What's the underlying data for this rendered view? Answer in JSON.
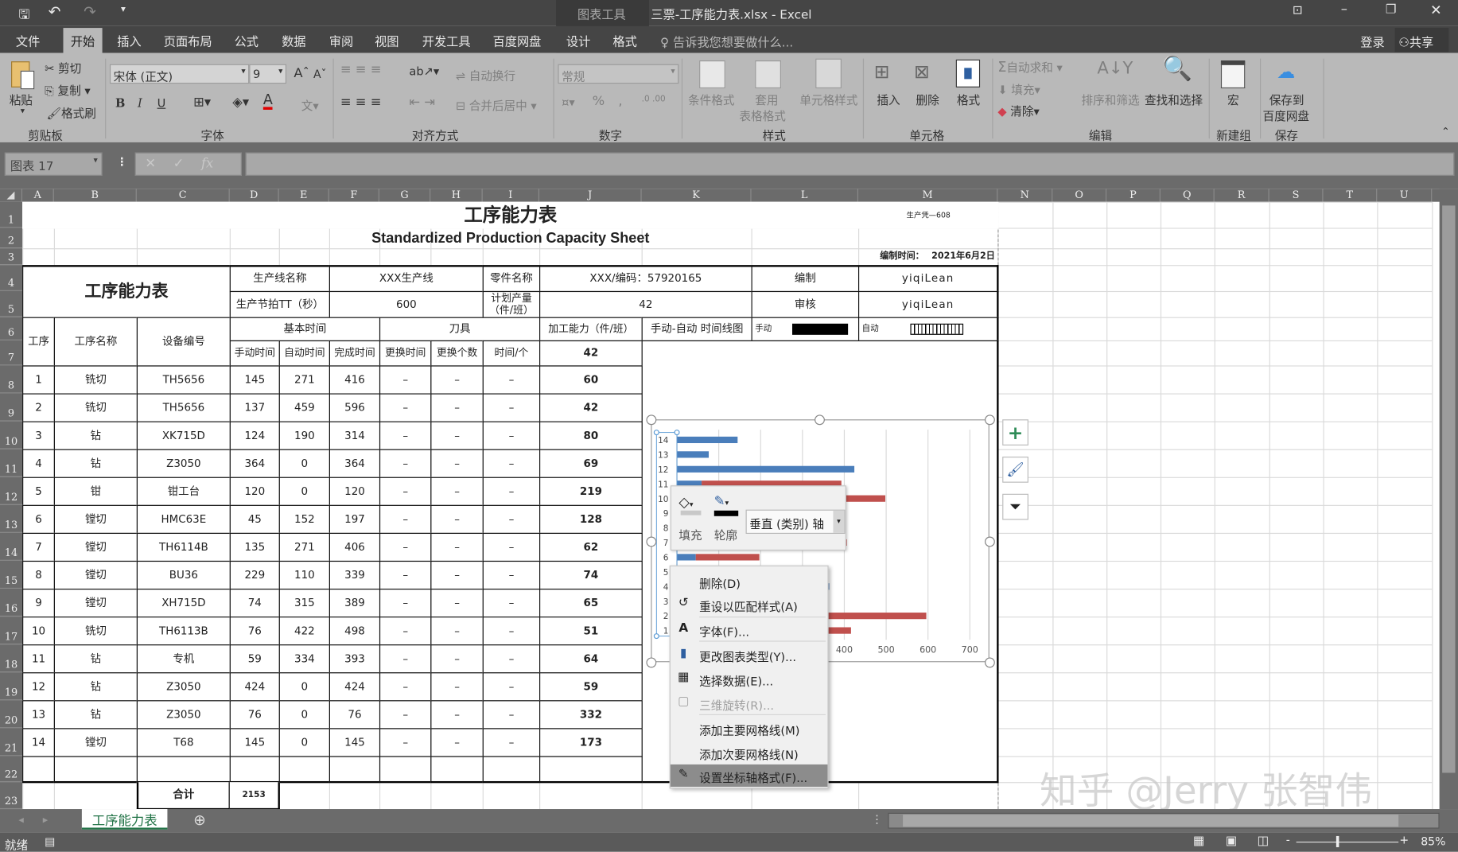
{
  "titlebar": {
    "context_tab": "图表工具",
    "title": "三票-工序能力表.xlsx - Excel"
  },
  "menu_tabs": [
    "文件",
    "开始",
    "插入",
    "页面布局",
    "公式",
    "数据",
    "审阅",
    "视图",
    "开发工具",
    "百度网盘",
    "设计",
    "格式"
  ],
  "tell_me": "告诉我您想要做什么...",
  "login": "登录",
  "share": "共享",
  "ribbon": {
    "clipboard": {
      "paste": "粘贴",
      "cut": "剪切",
      "copy": "复制",
      "format_painter": "格式刷",
      "group": "剪贴板"
    },
    "font": {
      "font_name": "宋体 (正文)",
      "font_size": "9",
      "bold": "B",
      "italic": "I",
      "underline": "U",
      "group": "字体"
    },
    "alignment": {
      "wrap": "自动换行",
      "merge": "合并后居中",
      "group": "对齐方式"
    },
    "number": {
      "format": "常规",
      "percent": "%",
      "comma": ",",
      "group": "数字"
    },
    "styles": {
      "conditional": "条件格式",
      "table_format_1": "套用",
      "table_format_2": "表格格式",
      "cell_styles": "单元格样式",
      "group": "样式"
    },
    "cells": {
      "insert": "插入",
      "delete": "删除",
      "format": "格式",
      "group": "单元格"
    },
    "editing": {
      "autosum": "自动求和",
      "fill": "填充",
      "clear": "清除",
      "sort_filter": "排序和筛选",
      "find_select": "查找和选择",
      "group": "编辑"
    },
    "newgroup": {
      "macro": "宏",
      "group": "新建组"
    },
    "save": {
      "save_1": "保存到",
      "save_2": "百度网盘",
      "group": "保存"
    }
  },
  "namebox": "图表 17",
  "fx": "fx",
  "columns": [
    "A",
    "B",
    "C",
    "D",
    "E",
    "F",
    "G",
    "H",
    "I",
    "J",
    "K",
    "L",
    "M",
    "N",
    "O",
    "P",
    "Q",
    "R",
    "S",
    "T",
    "U"
  ],
  "rows": [
    "1",
    "2",
    "3",
    "4",
    "5",
    "6",
    "7",
    "8",
    "9",
    "10",
    "11",
    "12",
    "13",
    "14",
    "15",
    "16",
    "17",
    "18",
    "19",
    "20",
    "21",
    "22",
    "23"
  ],
  "sheet": {
    "title": "工序能力表",
    "subtitle": "Standardized Production Capacity Sheet",
    "doc_no": "生产凭—608",
    "date_label": "编制时间：",
    "date": "2021年6月2日",
    "left_title": "工序能力表",
    "line_name_label": "生产线名称",
    "line_name": "XXX生产线",
    "part_name_label": "零件名称",
    "part_name": "XXX/编码：57920165",
    "compiled_label": "编制",
    "compiled_by": "yiqiLean",
    "takt_label": "生产节拍TT（秒）",
    "takt": "600",
    "plan_label": "计划产量（件/班）",
    "plan": "42",
    "review_label": "审核",
    "reviewed_by": "yiqiLean",
    "h_seq": "工序",
    "h_name": "工序名称",
    "h_equip": "设备编号",
    "h_basic": "基本时间",
    "h_tool": "刀具",
    "h_capacity": "加工能力（件/班）",
    "h_timeline": "手动-自动 时间线图",
    "legend_manual": "手动",
    "legend_auto": "自动",
    "h_manual": "手动时间",
    "h_auto": "自动时间",
    "h_total": "完成时间",
    "h_change_time": "更换时间",
    "h_change_count": "更换个数",
    "h_per_piece": "时间/个",
    "min_capacity": "42",
    "process_rows": [
      {
        "seq": "1",
        "name": "铣切",
        "equip": "TH5656",
        "manual": "145",
        "auto": "271",
        "total": "416",
        "ct": "–",
        "cc": "–",
        "pp": "–",
        "cap": "60"
      },
      {
        "seq": "2",
        "name": "铣切",
        "equip": "TH5656",
        "manual": "137",
        "auto": "459",
        "total": "596",
        "ct": "–",
        "cc": "–",
        "pp": "–",
        "cap": "42"
      },
      {
        "seq": "3",
        "name": "钻",
        "equip": "XK715D",
        "manual": "124",
        "auto": "190",
        "total": "314",
        "ct": "–",
        "cc": "–",
        "pp": "–",
        "cap": "80"
      },
      {
        "seq": "4",
        "name": "钻",
        "equip": "Z3050",
        "manual": "364",
        "auto": "0",
        "total": "364",
        "ct": "–",
        "cc": "–",
        "pp": "–",
        "cap": "69"
      },
      {
        "seq": "5",
        "name": "钳",
        "equip": "钳工台",
        "manual": "120",
        "auto": "0",
        "total": "120",
        "ct": "–",
        "cc": "–",
        "pp": "–",
        "cap": "219"
      },
      {
        "seq": "6",
        "name": "镗切",
        "equip": "HMC63E",
        "manual": "45",
        "auto": "152",
        "total": "197",
        "ct": "–",
        "cc": "–",
        "pp": "–",
        "cap": "128"
      },
      {
        "seq": "7",
        "name": "镗切",
        "equip": "TH6114B",
        "manual": "135",
        "auto": "271",
        "total": "406",
        "ct": "–",
        "cc": "–",
        "pp": "–",
        "cap": "62"
      },
      {
        "seq": "8",
        "name": "镗切",
        "equip": "BU36",
        "manual": "229",
        "auto": "110",
        "total": "339",
        "ct": "–",
        "cc": "–",
        "pp": "–",
        "cap": "74"
      },
      {
        "seq": "9",
        "name": "镗切",
        "equip": "XH715D",
        "manual": "74",
        "auto": "315",
        "total": "389",
        "ct": "–",
        "cc": "–",
        "pp": "–",
        "cap": "65"
      },
      {
        "seq": "10",
        "name": "铣切",
        "equip": "TH6113B",
        "manual": "76",
        "auto": "422",
        "total": "498",
        "ct": "–",
        "cc": "–",
        "pp": "–",
        "cap": "51"
      },
      {
        "seq": "11",
        "name": "钻",
        "equip": "专机",
        "manual": "59",
        "auto": "334",
        "total": "393",
        "ct": "–",
        "cc": "–",
        "pp": "–",
        "cap": "64"
      },
      {
        "seq": "12",
        "name": "钻",
        "equip": "Z3050",
        "manual": "424",
        "auto": "0",
        "total": "424",
        "ct": "–",
        "cc": "–",
        "pp": "–",
        "cap": "59"
      },
      {
        "seq": "13",
        "name": "钻",
        "equip": "Z3050",
        "manual": "76",
        "auto": "0",
        "total": "76",
        "ct": "–",
        "cc": "–",
        "pp": "–",
        "cap": "332"
      },
      {
        "seq": "14",
        "name": "镗切",
        "equip": "T68",
        "manual": "145",
        "auto": "0",
        "total": "145",
        "ct": "–",
        "cc": "–",
        "pp": "–",
        "cap": "173"
      }
    ],
    "total_label": "合计",
    "total": "2153"
  },
  "chart_data": {
    "type": "bar",
    "orientation": "horizontal",
    "stacked": true,
    "categories": [
      "1",
      "2",
      "3",
      "4",
      "5",
      "6",
      "7",
      "8",
      "9",
      "10",
      "11",
      "12",
      "13",
      "14"
    ],
    "series": [
      {
        "name": "手动时间",
        "color": "#4a7ebb",
        "values": [
          145,
          137,
          124,
          364,
          120,
          45,
          135,
          229,
          74,
          76,
          59,
          424,
          76,
          145
        ]
      },
      {
        "name": "自动时间",
        "color": "#c0504d",
        "values": [
          271,
          459,
          190,
          0,
          0,
          152,
          271,
          110,
          315,
          422,
          334,
          0,
          0,
          0
        ]
      }
    ],
    "xlim": [
      0,
      700
    ],
    "x_ticks": [
      "400",
      "500",
      "600",
      "700"
    ],
    "grid": true
  },
  "mini_toolbar": {
    "fill": "填充",
    "outline": "轮廓",
    "element": "垂直 (类别) 轴"
  },
  "context_menu": [
    {
      "label": "删除(D)",
      "icon": "none"
    },
    {
      "label": "重设以匹配样式(A)",
      "icon": "reset-style-icon"
    },
    {
      "label": "字体(F)...",
      "icon": "font-icon"
    },
    {
      "label": "更改图表类型(Y)...",
      "icon": "chart-type-icon"
    },
    {
      "label": "选择数据(E)...",
      "icon": "select-data-icon"
    },
    {
      "label": "三维旋转(R)...",
      "icon": "rotate-3d-icon",
      "disabled": true
    },
    {
      "label": "添加主要网格线(M)",
      "icon": "none"
    },
    {
      "label": "添加次要网格线(N)",
      "icon": "none"
    },
    {
      "label": "设置坐标轴格式(F)...",
      "icon": "format-axis-icon",
      "highlighted": true
    }
  ],
  "sheet_tab": "工序能力表",
  "status": "就绪",
  "zoom": "85%",
  "watermark": "知乎 @Jerry 张智伟",
  "colors": {
    "manual_bar": "#4a7ebb",
    "auto_bar": "#c0504d",
    "chrome_dark": "#454545",
    "ribbon": "#b9b9b9"
  }
}
